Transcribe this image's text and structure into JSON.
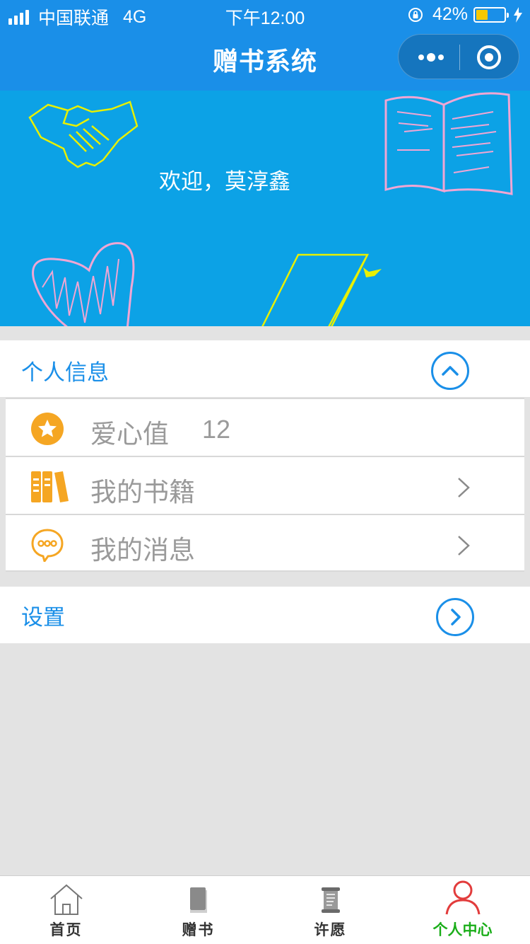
{
  "status_bar": {
    "carrier": "中国联通",
    "network": "4G",
    "time": "下午12:00",
    "battery_percent": "42%",
    "battery_level": 0.42,
    "battery_color": "#f7c800"
  },
  "nav": {
    "title": "赠书系统",
    "bg_color": "#1a8fe8"
  },
  "banner": {
    "welcome": "欢迎，莫淳鑫",
    "bg_color": "#0ca2e6"
  },
  "personal_info": {
    "title": "个人信息",
    "toggle_icon": "chevron-up-circle-icon",
    "items": [
      {
        "label": "爱心值",
        "value": "12",
        "icon": "star-badge-icon"
      },
      {
        "label": "我的书籍",
        "icon": "books-icon",
        "action_icon": "chevron-right-icon"
      },
      {
        "label": "我的消息",
        "icon": "chat-bubble-icon",
        "action_icon": "chevron-right-icon"
      }
    ]
  },
  "settings": {
    "title": "设置",
    "action_icon": "chevron-right-circle-icon"
  },
  "tab_bar": {
    "tabs": [
      {
        "label": "首页",
        "icon": "home-icon",
        "active": false
      },
      {
        "label": "赠书",
        "icon": "book-icon",
        "active": false
      },
      {
        "label": "许愿",
        "icon": "scroll-icon",
        "active": false
      },
      {
        "label": "个人中心",
        "icon": "person-icon",
        "active": true
      }
    ],
    "active_color": "#1aad19"
  },
  "colors": {
    "accent": "#1a8fe8",
    "icon_orange": "#f5a623"
  }
}
